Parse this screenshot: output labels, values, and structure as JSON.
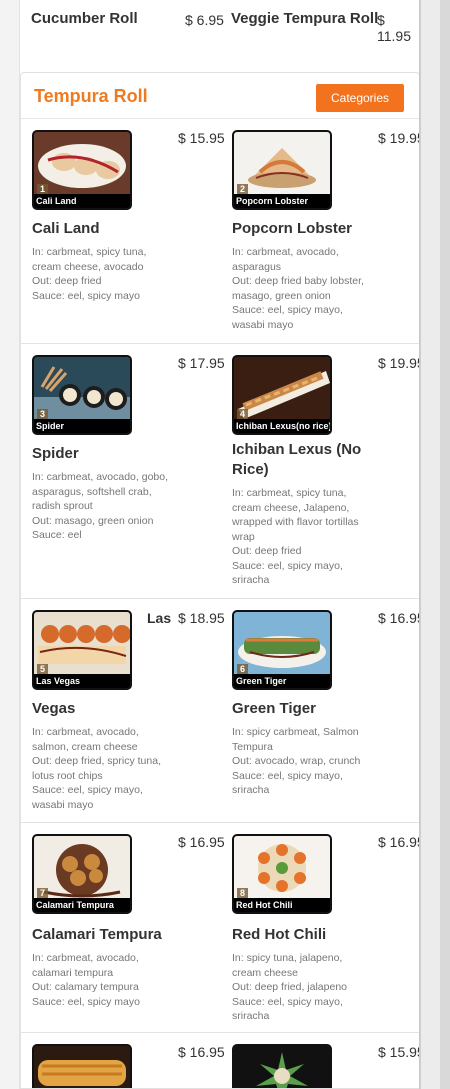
{
  "top_row": {
    "left_name": "Cucumber Roll",
    "left_price": "$ 6.95",
    "right_name": "Veggie Tempura Roll",
    "right_price": "$ 11.95"
  },
  "section": {
    "title": "Tempura Roll",
    "categories_button": "Categories"
  },
  "items": [
    {
      "num": "1",
      "caption": "Cali Land",
      "name": "Cali Land",
      "price": "$ 15.95",
      "lines": [
        "In: carbmeat, spicy tuna,",
        "cream cheese, avocado",
        "Out: deep fried",
        "Sauce: eel, spicy mayo"
      ]
    },
    {
      "num": "2",
      "caption": "Popcorn Lobster",
      "name": "Popcorn Lobster",
      "price": "$ 19.95",
      "lines": [
        "In: carbmeat, avocado,",
        "asparagus",
        "Out: deep fried baby lobster,",
        "masago, green onion",
        "Sauce: eel, spicy mayo,",
        "wasabi mayo"
      ]
    },
    {
      "num": "3",
      "caption": "Spider",
      "name": "Spider",
      "price": "$ 17.95",
      "lines": [
        "In: carbmeat, avocado, gobo,",
        "asparagus, softshell crab,",
        "radish sprout",
        "Out: masago, green onion",
        "Sauce: eel"
      ]
    },
    {
      "num": "4",
      "caption": "Ichiban Lexus(no rice)",
      "name": "Ichiban Lexus (No Rice)",
      "price": "$ 19.95",
      "lines": [
        "In: carbmeat, spicy tuna,",
        "cream cheese, Jalapeno,",
        "wrapped with flavor tortillas",
        "wrap",
        "Out: deep fried",
        "Sauce: eel, spicy mayo,",
        "sriracha"
      ]
    },
    {
      "num": "5",
      "caption": "Las Vegas",
      "name": "Vegas",
      "extra": "Las",
      "price": "$ 18.95",
      "lines": [
        "In: carbmeat, avocado,",
        "salmon, cream cheese",
        "Out: deep fried, spricy tuna,",
        "lotus root chips",
        "Sauce: eel, spicy mayo,",
        "wasabi mayo"
      ]
    },
    {
      "num": "6",
      "caption": "Green Tiger",
      "name": "Green Tiger",
      "price": "$ 16.95",
      "lines": [
        "In: spicy carbmeat, Salmon",
        "Tempura",
        "Out: avocado, wrap, crunch",
        "Sauce: eel, spicy mayo,",
        "sriracha"
      ]
    },
    {
      "num": "7",
      "caption": "Calamari Tempura",
      "name": "Calamari Tempura",
      "price": "$ 16.95",
      "lines": [
        "In: carbmeat, avocado,",
        "calamari tempura",
        "Out: calamary tempura",
        "Sauce: eel, spicy mayo"
      ]
    },
    {
      "num": "8",
      "caption": "Red Hot Chili",
      "name": "Red Hot Chili",
      "price": "$ 16.95",
      "lines": [
        "In: spicy tuna, jalapeno,",
        "cream cheese",
        "Out: deep fried, jalapeno",
        "Sauce: eel, spicy mayo,",
        "sriracha"
      ]
    },
    {
      "num": "",
      "caption": "",
      "name": "",
      "price": "$ 16.95",
      "lines": []
    },
    {
      "num": "",
      "caption": "",
      "name": "",
      "price": "$ 15.95",
      "lines": []
    }
  ]
}
